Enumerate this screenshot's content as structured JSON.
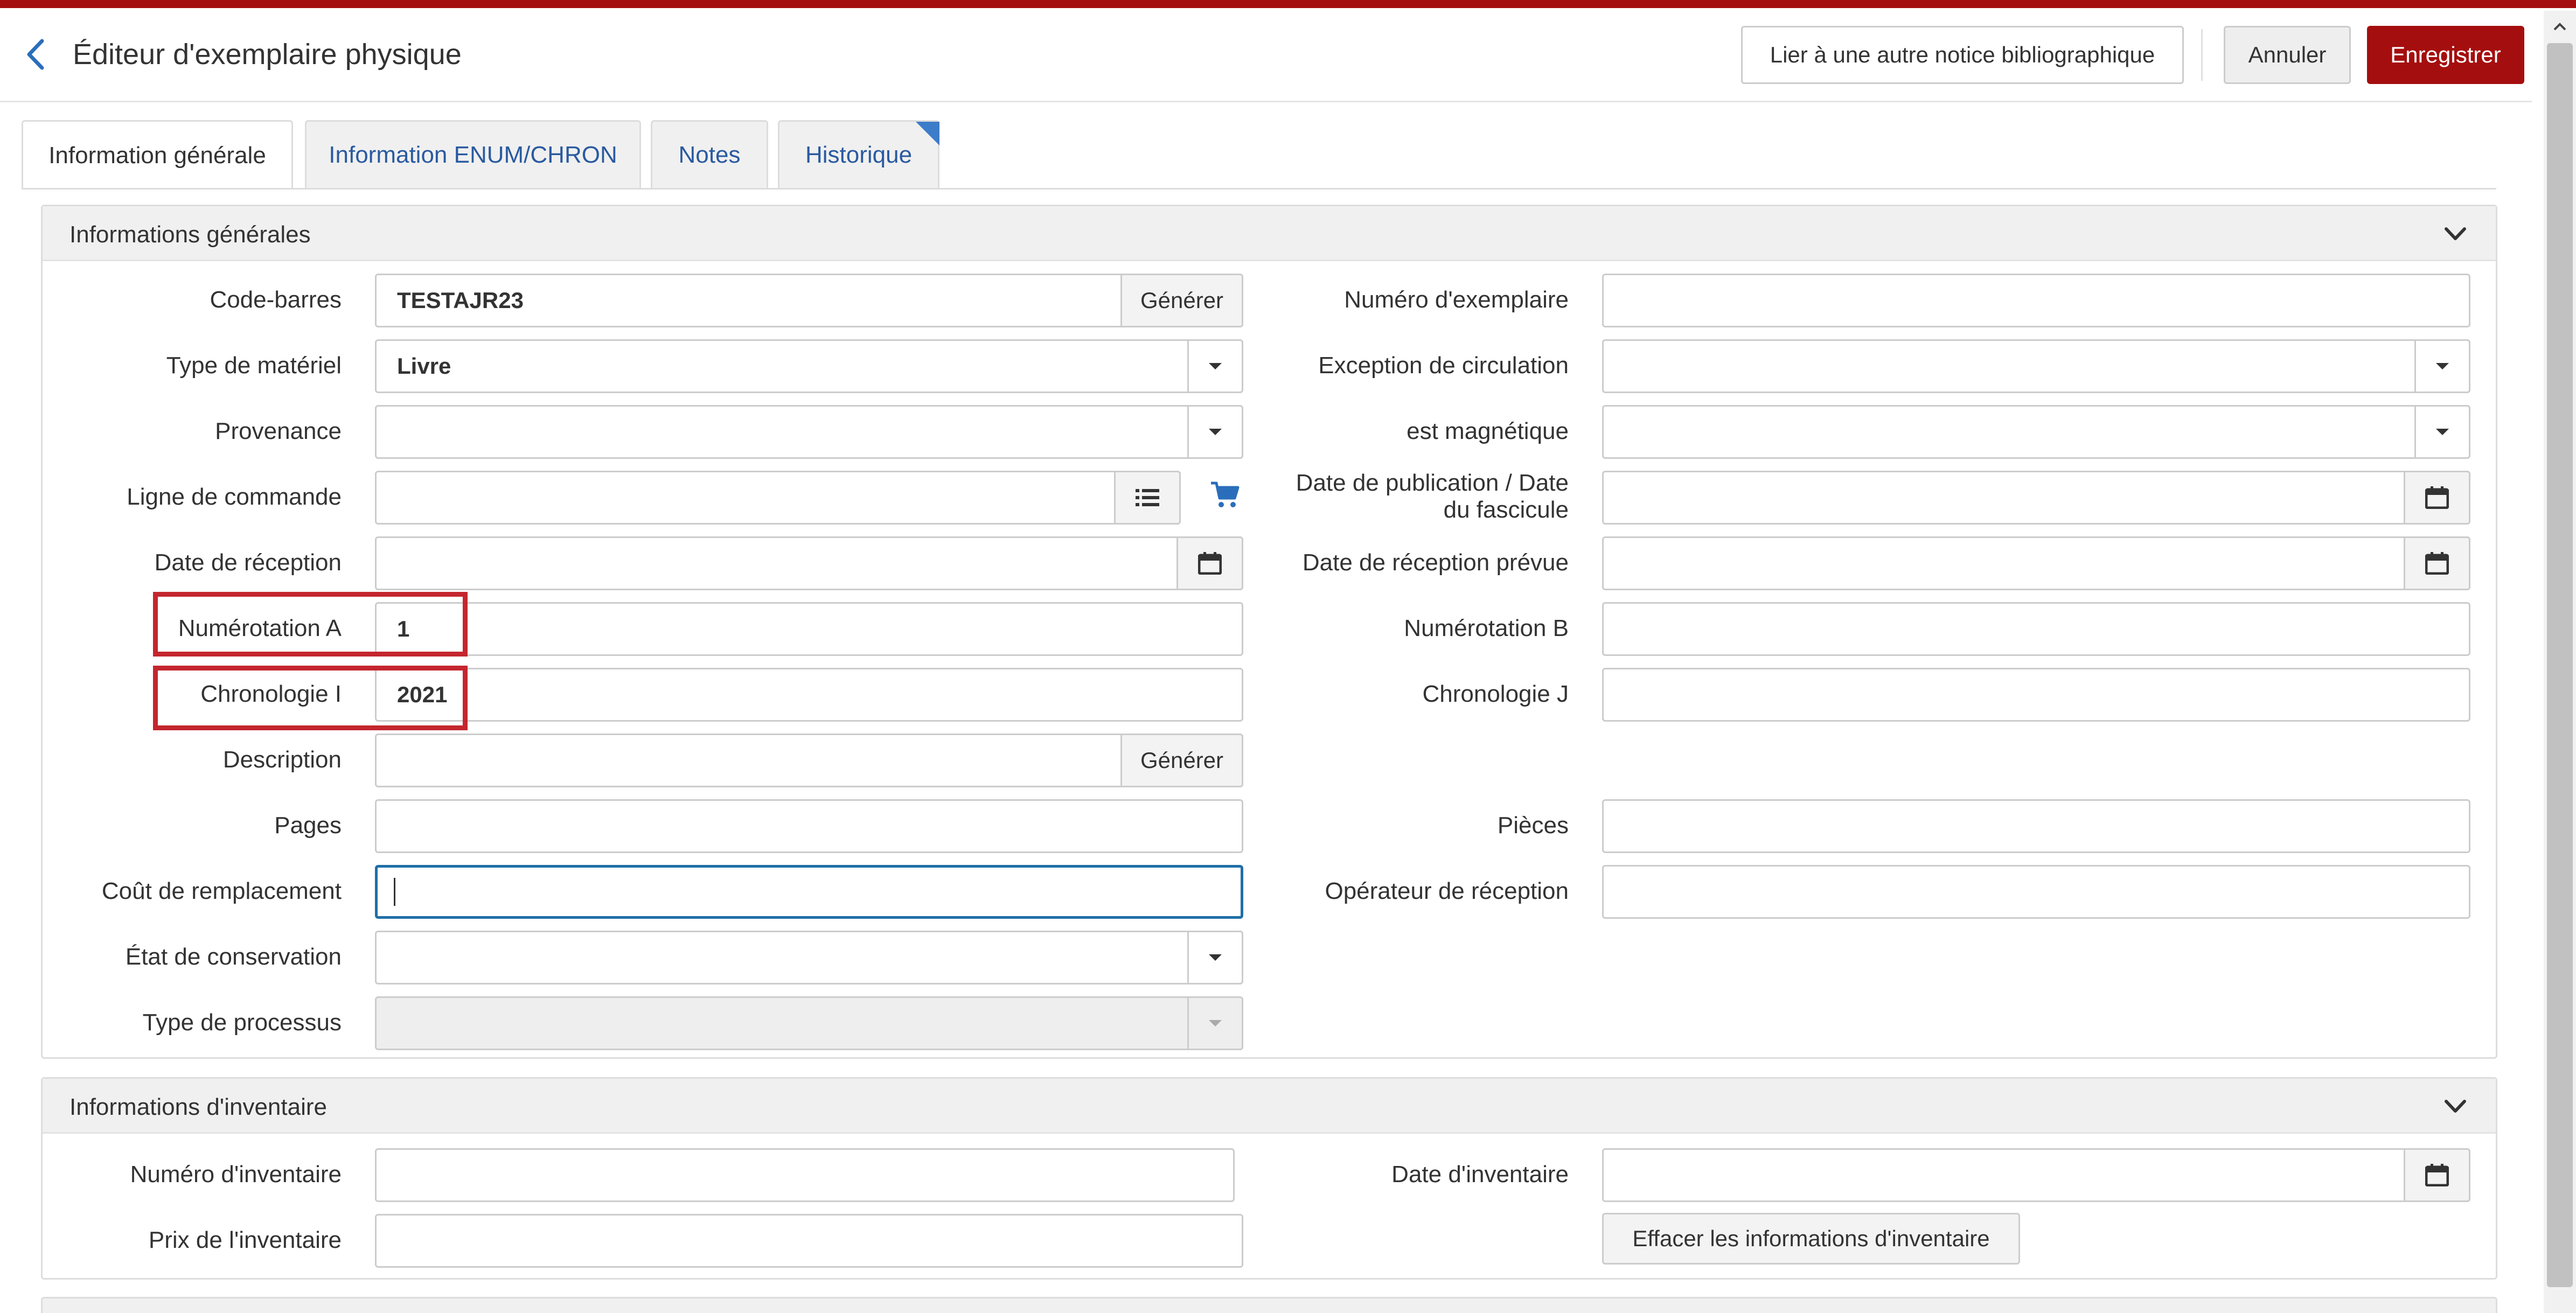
{
  "header": {
    "title": "Éditeur d'exemplaire physique",
    "link_button": "Lier à une autre notice bibliographique",
    "cancel_button": "Annuler",
    "save_button": "Enregistrer"
  },
  "colors": {
    "brand": "#a50e0e",
    "link": "#2a5aa0",
    "focus": "#1f6fa8",
    "highlight": "#c4262e"
  },
  "tabs": [
    {
      "label": "Information générale",
      "active": true
    },
    {
      "label": "Information ENUM/CHRON",
      "active": false
    },
    {
      "label": "Notes",
      "active": false
    },
    {
      "label": "Historique",
      "active": false
    }
  ],
  "general": {
    "title": "Informations générales",
    "barcode": {
      "label": "Code-barres",
      "value": "TESTAJR23",
      "button": "Générer"
    },
    "material_type": {
      "label": "Type de matériel",
      "value": "Livre"
    },
    "provenance": {
      "label": "Provenance",
      "value": ""
    },
    "order_line": {
      "label": "Ligne de commande",
      "value": ""
    },
    "receipt_date": {
      "label": "Date de réception",
      "value": ""
    },
    "enum_a": {
      "label": "Numérotation A",
      "value": "1"
    },
    "chron_i": {
      "label": "Chronologie I",
      "value": "2021"
    },
    "description": {
      "label": "Description",
      "value": "",
      "button": "Générer"
    },
    "pages": {
      "label": "Pages",
      "value": ""
    },
    "replacement_cost": {
      "label": "Coût de remplacement",
      "value": ""
    },
    "condition": {
      "label": "État de conservation",
      "value": ""
    },
    "process_type": {
      "label": "Type de processus",
      "value": ""
    },
    "item_number": {
      "label": "Numéro d'exemplaire",
      "value": ""
    },
    "circ_exception": {
      "label": "Exception de circulation",
      "value": ""
    },
    "magnetic": {
      "label": "est magnétique",
      "value": ""
    },
    "pub_date": {
      "label": "Date de publication / Date du fascicule",
      "value": ""
    },
    "expected_receipt": {
      "label": "Date de réception prévue",
      "value": ""
    },
    "enum_b": {
      "label": "Numérotation B",
      "value": ""
    },
    "chron_j": {
      "label": "Chronologie J",
      "value": ""
    },
    "pieces": {
      "label": "Pièces",
      "value": ""
    },
    "receiving_operator": {
      "label": "Opérateur de réception",
      "value": ""
    }
  },
  "inventory": {
    "title": "Informations d'inventaire",
    "number": {
      "label": "Numéro d'inventaire",
      "value": ""
    },
    "price": {
      "label": "Prix de l'inventaire",
      "value": ""
    },
    "date": {
      "label": "Date d'inventaire",
      "value": ""
    },
    "clear_button": "Effacer les informations d'inventaire"
  },
  "icons": {
    "back": "chevron-left-icon",
    "collapse": "chevron-down-icon",
    "calendar": "calendar-icon",
    "list": "list-icon",
    "cart": "cart-icon",
    "dropdown": "caret-down-icon"
  }
}
